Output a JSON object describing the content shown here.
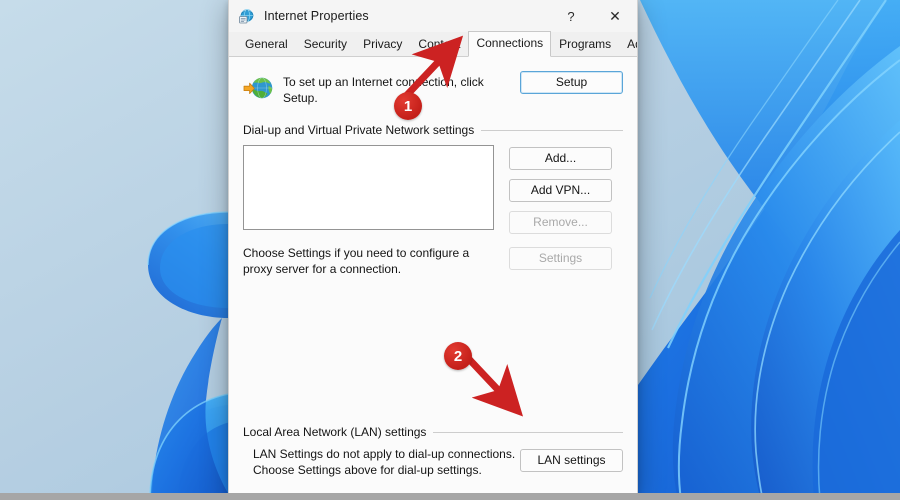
{
  "window": {
    "title": "Internet Properties",
    "icon": "internet-properties-icon",
    "help_button": "?",
    "close_button": "✕"
  },
  "tabs": [
    {
      "label": "General",
      "active": false
    },
    {
      "label": "Security",
      "active": false
    },
    {
      "label": "Privacy",
      "active": false
    },
    {
      "label": "Content",
      "active": false
    },
    {
      "label": "Connections",
      "active": true
    },
    {
      "label": "Programs",
      "active": false
    },
    {
      "label": "Advanced",
      "active": false
    }
  ],
  "connections": {
    "intro_text": "To set up an Internet connection, click Setup.",
    "intro_icon": "globe-connection-icon",
    "setup_button": "Setup",
    "dialup_group_label": "Dial-up and Virtual Private Network settings",
    "dialup_list_items": [],
    "dialup_buttons": [
      {
        "label": "Add...",
        "disabled": false
      },
      {
        "label": "Add VPN...",
        "disabled": false
      },
      {
        "label": "Remove...",
        "disabled": true
      }
    ],
    "proxy_text": "Choose Settings if you need to configure a proxy server for a connection.",
    "proxy_settings_button": {
      "label": "Settings",
      "disabled": true
    },
    "lan_group_label": "Local Area Network (LAN) settings",
    "lan_text_line1": "LAN Settings do not apply to dial-up connections.",
    "lan_text_line2": "Choose Settings above for dial-up settings.",
    "lan_settings_button": "LAN settings"
  },
  "annotations": [
    {
      "badge": "1",
      "target": "Connections tab",
      "color": "#cc2222"
    },
    {
      "badge": "2",
      "target": "LAN settings button",
      "color": "#cc2222"
    }
  ],
  "colors": {
    "annotation_red": "#cc2222",
    "dialog_background": "#fbfbfb",
    "wallpaper_blue": "#1472d8",
    "wallpaper_light": "#bcd4e6"
  }
}
